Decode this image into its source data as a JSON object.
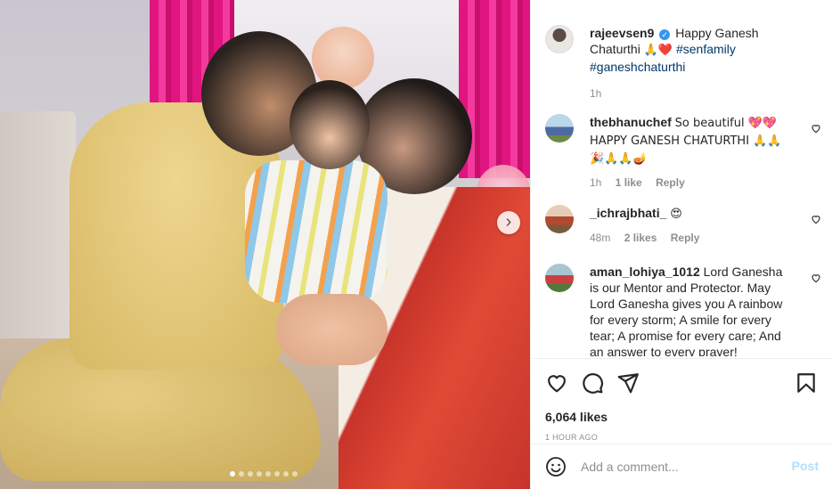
{
  "post": {
    "author": "rajeevsen9",
    "caption_text": "Happy Ganesh Chaturthi",
    "caption_emojis": "🙏❤️",
    "hashtags": [
      "#senfamily",
      "#ganeshchaturthi"
    ],
    "posted_ago": "1h",
    "carousel_slides": 8,
    "carousel_active": 1
  },
  "comments": [
    {
      "username": "thebhanuchef",
      "text": "So beautiful 💖💖 HAPPY GANESH CHATURTHI 🙏🙏 🎉🙏🙏🪔",
      "age": "1h",
      "likes": "1 like",
      "reply": "Reply"
    },
    {
      "username": "_ichrajbhati_",
      "text": "😍",
      "age": "48m",
      "likes": "2 likes",
      "reply": "Reply"
    },
    {
      "username": "aman_lohiya_1012",
      "text": "Lord Ganesha is our Mentor and Protector. May Lord Ganesha gives you A rainbow for every storm; A smile for every tear; A promise for every care; And an answer to every prayer!",
      "age": "",
      "likes": "",
      "reply": ""
    }
  ],
  "actions": {
    "like_icon": "heart-icon",
    "comment_icon": "comment-icon",
    "share_icon": "share-icon",
    "save_icon": "bookmark-icon",
    "likes_count": "6,064 likes",
    "timestamp": "1 HOUR AGO"
  },
  "add_comment": {
    "placeholder": "Add a comment...",
    "post_label": "Post",
    "emoji_icon": "smiley-icon"
  },
  "colors": {
    "link": "#00376b",
    "verified": "#3897f0",
    "post_disabled": "#b2dffc",
    "muted": "#8e8e8e"
  }
}
